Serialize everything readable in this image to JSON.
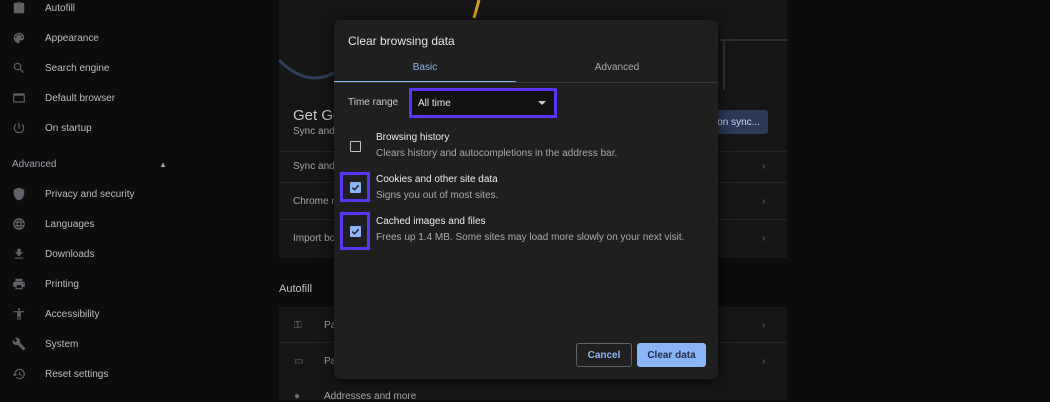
{
  "sidebar": {
    "items_top": [
      {
        "label": "Autofill",
        "icon": "clipboard-icon"
      },
      {
        "label": "Appearance",
        "icon": "palette-icon"
      },
      {
        "label": "Search engine",
        "icon": "search-icon"
      },
      {
        "label": "Default browser",
        "icon": "browser-window-icon"
      },
      {
        "label": "On startup",
        "icon": "power-icon"
      }
    ],
    "section_label": "Advanced",
    "items_advanced": [
      {
        "label": "Privacy and security",
        "icon": "shield-icon"
      },
      {
        "label": "Languages",
        "icon": "globe-icon"
      },
      {
        "label": "Downloads",
        "icon": "download-icon"
      },
      {
        "label": "Printing",
        "icon": "printer-icon"
      },
      {
        "label": "Accessibility",
        "icon": "accessibility-icon"
      },
      {
        "label": "System",
        "icon": "wrench-icon"
      },
      {
        "label": "Reset settings",
        "icon": "history-icon"
      }
    ]
  },
  "background": {
    "get_title": "Get Go",
    "sync_sub": "Sync and",
    "sync_button": "on sync...",
    "rows": [
      "Sync and",
      "Chrome n",
      "Import bo"
    ],
    "autofill_header": "Autofill",
    "autofill_rows": [
      "Pa",
      "Pa",
      "Addresses and more"
    ]
  },
  "dialog": {
    "title": "Clear browsing data",
    "tabs": [
      "Basic",
      "Advanced"
    ],
    "time_range_label": "Time range",
    "time_range_value": "All time",
    "options": [
      {
        "title": "Browsing history",
        "subtitle": "Clears history and autocompletions in the address bar.",
        "checked": false
      },
      {
        "title": "Cookies and other site data",
        "subtitle": "Signs you out of most sites.",
        "checked": true
      },
      {
        "title": "Cached images and files",
        "subtitle": "Frees up 1.4 MB. Some sites may load more slowly on your next visit.",
        "checked": true
      }
    ],
    "cancel_label": "Cancel",
    "clear_label": "Clear data"
  },
  "colors": {
    "accent": "#8ab4f8",
    "highlight": "#5a35f4",
    "dialog_bg": "#1f1f1f"
  }
}
